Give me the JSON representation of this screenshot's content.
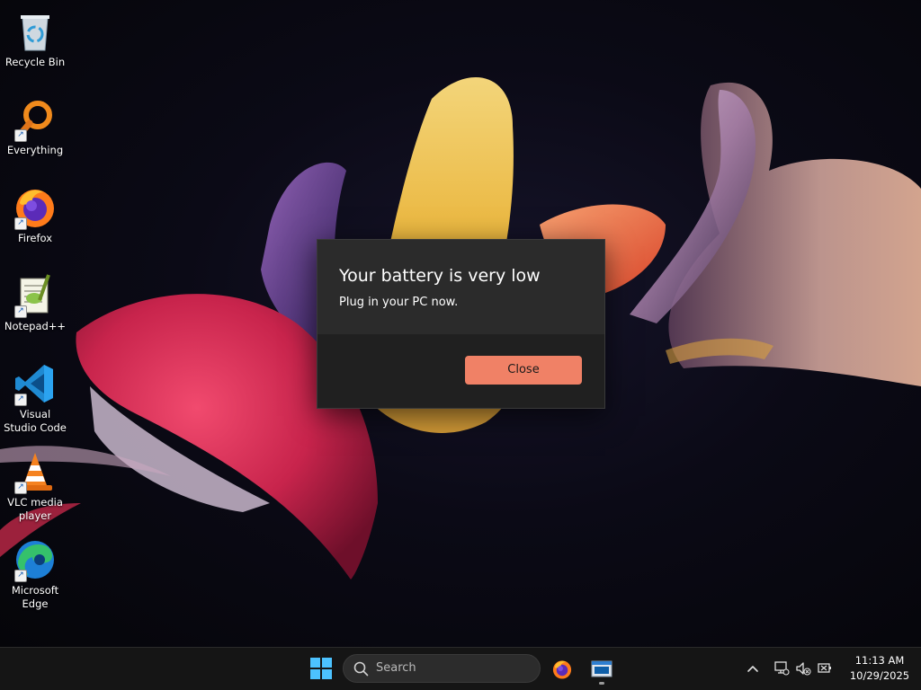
{
  "desktop": {
    "icons": [
      {
        "label": "Recycle Bin",
        "icon": "recycle-bin-icon",
        "shortcut": false
      },
      {
        "label": "Everything",
        "icon": "everything-search-icon",
        "shortcut": true
      },
      {
        "label": "Firefox",
        "icon": "firefox-icon",
        "shortcut": true
      },
      {
        "label": "Notepad++",
        "icon": "notepad-plus-plus-icon",
        "shortcut": true
      },
      {
        "label": "Visual Studio Code",
        "icon": "vscode-icon",
        "shortcut": true
      },
      {
        "label": "VLC media player",
        "icon": "vlc-icon",
        "shortcut": true
      },
      {
        "label": "Microsoft Edge",
        "icon": "edge-icon",
        "shortcut": true
      }
    ]
  },
  "dialog": {
    "title": "Your battery is very low",
    "message": "Plug in your PC now.",
    "close_label": "Close",
    "accent_color": "#f08166"
  },
  "taskbar": {
    "search_placeholder": "Search",
    "apps": [
      {
        "name": "Firefox",
        "icon": "firefox-icon"
      },
      {
        "name": "App window",
        "icon": "app-window-icon",
        "running": true
      }
    ],
    "tray": {
      "icons": [
        "chevron-up-icon",
        "network-icon",
        "volume-muted-icon",
        "battery-icon"
      ]
    },
    "clock": {
      "time": "11:13 AM",
      "date": "10/29/2025"
    }
  }
}
